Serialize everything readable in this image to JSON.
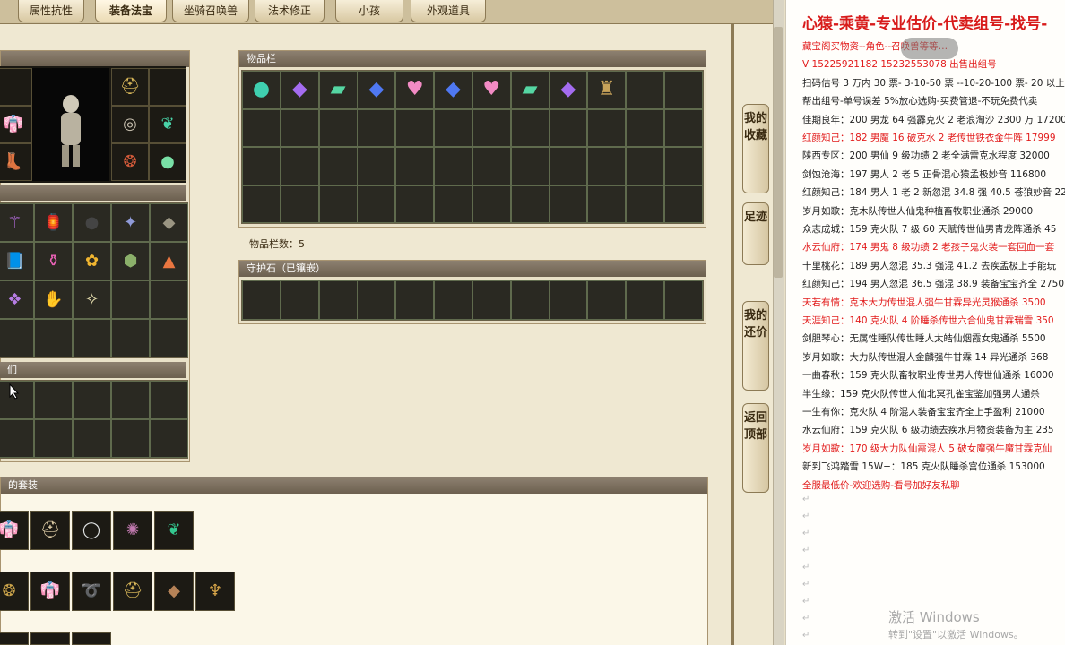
{
  "tabs": [
    {
      "label": "属性抗性",
      "active": false
    },
    {
      "label": "装备法宝",
      "active": true
    },
    {
      "label": "坐骑召唤兽",
      "active": false
    },
    {
      "label": "法术修正",
      "active": false
    },
    {
      "label": "小孩",
      "active": false
    },
    {
      "label": "外观道具",
      "active": false
    }
  ],
  "inventory": {
    "title": "物品栏",
    "count_label": "物品栏数：5",
    "items": [
      "teal-orb",
      "purple-crystal",
      "green-gem",
      "blue-crystal",
      "pink-heart",
      "blue-crystal",
      "pink-heart",
      "green-gem",
      "purple-crystal",
      "dark-armor"
    ]
  },
  "guard": {
    "title": "守护石（已镶嵌）"
  },
  "left_panel": {
    "lower_title": "们",
    "suit_title": "的套装"
  },
  "sidebar": [
    "我的收藏",
    "足迹",
    "我的还价",
    "返回顶部"
  ],
  "doc": {
    "header": "心猿-乘黄-专业估价-代卖组号-找号-",
    "lines": [
      {
        "text": "藏宝阁买物资--角色--召唤兽等等…",
        "red": true
      },
      {
        "text": "V 15225921182   15232553078 出售出组号",
        "red": true
      },
      {
        "text": "扫码估号 3 万内 30 票- 3-10-50 票  --10-20-100 票- 20 以上 1",
        "red": false
      },
      {
        "text": "帮出组号-单号误差 5%放心选购-买费管退-不玩免费代卖",
        "red": false
      },
      {
        "text": "佳期良年：200 男龙 64 强霹克火 2 老浪淘沙 2300 万 17200",
        "red": false
      },
      {
        "text": "红颜知己：182 男魔 16 破克水 2 老传世铁衣金牛阵 17999",
        "red": true
      },
      {
        "text": "陕西专区：200 男仙 9 级功绩 2 老全满雷克水程度 32000",
        "red": false
      },
      {
        "text": "剑蚀沧海：197 男人 2 老 5 正骨混心猿孟极妙音 116800",
        "red": false
      },
      {
        "text": "红颜知己：184 男人 1 老 2 新忽混 34.8 强 40.5 苍狼妙音 22",
        "red": false
      },
      {
        "text": "岁月如歌：克木队传世人仙鬼种植畜牧职业通杀 29000",
        "red": false
      },
      {
        "text": "众志成城：159 克火队 7 级 60 天赋传世仙男青龙阵通杀 45",
        "red": false
      },
      {
        "text": "水云仙府：174 男鬼 8 级功绩 2 老孩子鬼火装一套回血一套",
        "red": true
      },
      {
        "text": "十里桃花：189 男人忽混 35.3 强混 41.2 去疾孟极上手能玩",
        "red": false
      },
      {
        "text": "红颜知己：194 男人忽混 36.5 强混 38.9 装备宝宝齐全 2750",
        "red": false
      },
      {
        "text": "天若有情：克木大力传世混人强牛甘霖异光灵猴通杀 3500",
        "red": true
      },
      {
        "text": "天涯知己：140 克火队 4 阶睡杀传世六合仙鬼甘霖瑞雪 350",
        "red": true
      },
      {
        "text": "剑胆琴心：无属性睡队传世睡人太皓仙烟霞女鬼通杀 5500",
        "red": false
      },
      {
        "text": "岁月如歌：大力队传世混人金麟强牛甘霖 14 异光通杀 368",
        "red": false
      },
      {
        "text": "一曲春秋：159 克火队畜牧职业传世男人传世仙通杀 16000",
        "red": false
      },
      {
        "text": "半生缘：159 克火队传世人仙北冥孔雀宝鉴加强男人通杀",
        "red": false
      },
      {
        "text": "一生有你：克火队 4 阶混人装备宝宝齐全上手盈利 21000",
        "red": false
      },
      {
        "text": "水云仙府：159 克火队 6 级功绩去疾水月物资装备为主 235",
        "red": false
      },
      {
        "text": "岁月如歌：170 级大力队仙霞混人 5 破女魔强牛魔甘霖克仙",
        "red": true
      },
      {
        "text": "新到飞鸿踏雪 15W+：185 克火队睡杀宫位通杀 153000",
        "red": false
      },
      {
        "text": "全服最低价-欢迎选购-看号加好友私聊",
        "red": true
      }
    ],
    "watermark_title": "激活 Windows",
    "watermark_sub": "转到\"设置\"以激活 Windows。"
  }
}
